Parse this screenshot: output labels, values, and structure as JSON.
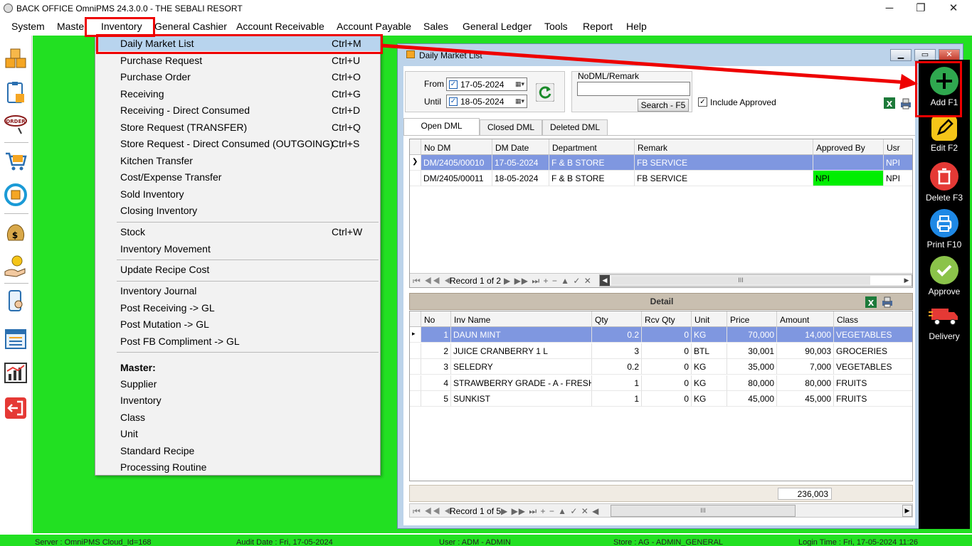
{
  "window": {
    "title": "BACK OFFICE OmniPMS 24.3.0.0 - THE SEBALI RESORT",
    "minimize": "─",
    "restore": "❐",
    "close": "✕"
  },
  "menu": [
    "System",
    "Maste",
    "Inventory",
    "General Cashier",
    "Account Receivable",
    "Account Payable",
    "Sales",
    "General Ledger",
    "Tools",
    "Report",
    "Help"
  ],
  "inventory_menu": {
    "group1": [
      {
        "label": "Daily Market List",
        "shortcut": "Ctrl+M"
      },
      {
        "label": "Purchase Request",
        "shortcut": "Ctrl+U"
      },
      {
        "label": "Purchase Order",
        "shortcut": "Ctrl+O"
      },
      {
        "label": "Receiving",
        "shortcut": "Ctrl+G"
      },
      {
        "label": "Receiving - Direct Consumed",
        "shortcut": "Ctrl+D"
      },
      {
        "label": "Store Request (TRANSFER)",
        "shortcut": "Ctrl+Q"
      },
      {
        "label": "Store Request - Direct Consumed (OUTGOING)",
        "shortcut": "Ctrl+S"
      },
      {
        "label": "Kitchen Transfer",
        "shortcut": ""
      },
      {
        "label": "Cost/Expense Transfer",
        "shortcut": ""
      },
      {
        "label": "Sold Inventory",
        "shortcut": ""
      },
      {
        "label": "Closing Inventory",
        "shortcut": ""
      }
    ],
    "group2": [
      {
        "label": "Stock",
        "shortcut": "Ctrl+W"
      },
      {
        "label": "Inventory Movement",
        "shortcut": ""
      }
    ],
    "group3": [
      {
        "label": "Update Recipe Cost",
        "shortcut": ""
      }
    ],
    "group4": [
      {
        "label": "Inventory Journal",
        "shortcut": ""
      },
      {
        "label": "Post Receiving -> GL",
        "shortcut": ""
      },
      {
        "label": "Post Mutation -> GL",
        "shortcut": ""
      },
      {
        "label": "Post FB Compliment -> GL",
        "shortcut": ""
      }
    ],
    "master_heading": "Master:",
    "master": [
      "Supplier",
      "Inventory",
      "Class",
      "Unit",
      "Standard Recipe",
      "Processing Routine"
    ]
  },
  "dml": {
    "title": "Daily Market List",
    "from_label": "From",
    "until_label": "Until",
    "from_date": "17-05-2024",
    "until_date": "18-05-2024",
    "search_group_label": "NoDML/Remark",
    "search_value": "",
    "search_button": "Search - F5",
    "include_approved": "Include Approved",
    "tabs": [
      "Open DML",
      "Closed DML",
      "Deleted DML"
    ],
    "columns": [
      "No DM",
      "DM Date",
      "Department",
      "Remark",
      "Approved By",
      "Usr"
    ],
    "rows": [
      {
        "no": "DM/2405/00010",
        "date": "17-05-2024",
        "dept": "F & B STORE",
        "remark": "FB SERVICE",
        "approved": "",
        "usr": "NPI"
      },
      {
        "no": "DM/2405/00011",
        "date": "18-05-2024",
        "dept": "F & B STORE",
        "remark": "FB SERVICE",
        "approved": "NPI",
        "usr": "NPI"
      }
    ],
    "record_nav": "Record 1 of 2",
    "detail_title": "Detail",
    "detail_columns": [
      "No",
      "Inv Name",
      "Qty",
      "Rcv Qty",
      "Unit",
      "Price",
      "Amount",
      "Class"
    ],
    "detail_rows": [
      {
        "no": "1",
        "name": "DAUN MINT",
        "qty": "0.2",
        "rcv": "0",
        "unit": "KG",
        "price": "70,000",
        "amount": "14,000",
        "cls": "VEGETABLES"
      },
      {
        "no": "2",
        "name": "JUICE CRANBERRY 1 L",
        "qty": "3",
        "rcv": "0",
        "unit": "BTL",
        "price": "30,001",
        "amount": "90,003",
        "cls": "GROCERIES"
      },
      {
        "no": "3",
        "name": "SELEDRY",
        "qty": "0.2",
        "rcv": "0",
        "unit": "KG",
        "price": "35,000",
        "amount": "7,000",
        "cls": "VEGETABLES"
      },
      {
        "no": "4",
        "name": "STRAWBERRY GRADE - A - FRESH",
        "qty": "1",
        "rcv": "0",
        "unit": "KG",
        "price": "80,000",
        "amount": "80,000",
        "cls": "FRUITS"
      },
      {
        "no": "5",
        "name": "SUNKIST",
        "qty": "1",
        "rcv": "0",
        "unit": "KG",
        "price": "45,000",
        "amount": "45,000",
        "cls": "FRUITS"
      }
    ],
    "total": "236,003",
    "detail_nav": "Record 1 of 5",
    "scroll_thumb": "III"
  },
  "actions": [
    {
      "label": "Add F1",
      "icon": "add-icon",
      "color": "#2fa84f"
    },
    {
      "label": "Edit F2",
      "icon": "edit-icon",
      "color": "#f5c518"
    },
    {
      "label": "Delete F3",
      "icon": "delete-icon",
      "color": "#e53935"
    },
    {
      "label": "Print F10",
      "icon": "print-icon",
      "color": "#1e88e5"
    },
    {
      "label": "Approve",
      "icon": "approve-icon",
      "color": "#8bc34a"
    },
    {
      "label": "Delivery",
      "icon": "delivery-icon",
      "color": "#e53935"
    }
  ],
  "status": {
    "server": "Server : OmniPMS Cloud_Id=168",
    "audit": "Audit Date : Fri, 17-05-2024",
    "user": "User : ADM - ADMIN",
    "store": "Store : AG - ADMIN_GENERAL",
    "login": "Login Time : Fri, 17-05-2024 11:26"
  },
  "colors": {
    "workspace": "#22e022",
    "highlight": "#ee0000",
    "selected_row": "#7f97e0",
    "approved_cell": "#00ee00"
  }
}
